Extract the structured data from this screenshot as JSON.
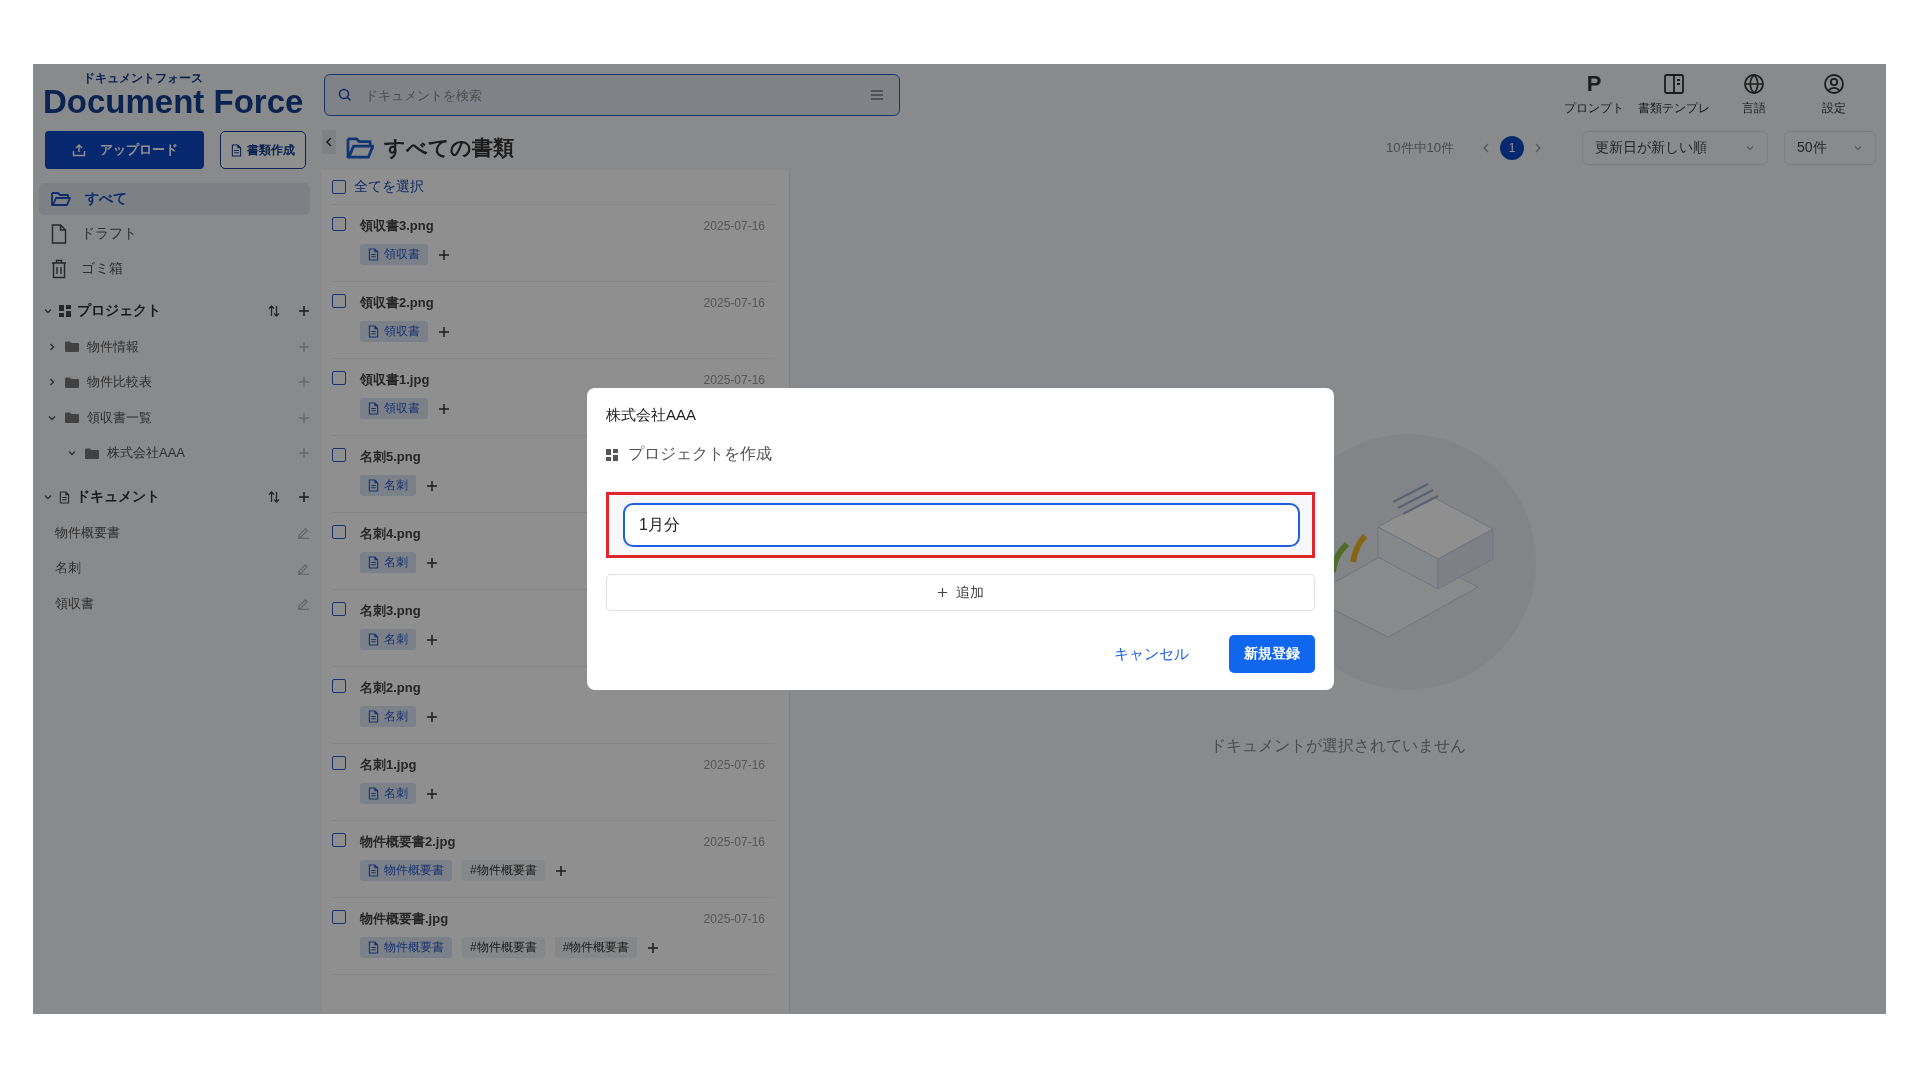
{
  "logo": {
    "kana": "ドキュメントフォース",
    "name": "Document Force"
  },
  "search": {
    "placeholder": "ドキュメントを検索"
  },
  "toolbar": [
    {
      "kind": "letter",
      "glyph": "P",
      "label": "プロンプト"
    },
    {
      "kind": "template",
      "label": "書類テンプレ"
    },
    {
      "kind": "globe",
      "label": "言語"
    },
    {
      "kind": "user",
      "label": "設定"
    }
  ],
  "sidebar": {
    "upload": "アップロード",
    "create": "書類作成",
    "nav": [
      {
        "kind": "folder",
        "label": "すべて",
        "selected": true
      },
      {
        "kind": "file",
        "label": "ドラフト",
        "selected": false
      },
      {
        "kind": "trash",
        "label": "ゴミ箱",
        "selected": false
      }
    ],
    "projects": {
      "title": "プロジェクト",
      "expanded": true,
      "children": [
        {
          "label": "物件情報",
          "expanded": false
        },
        {
          "label": "物件比較表",
          "expanded": false
        },
        {
          "label": "領収書一覧",
          "expanded": true,
          "children": [
            {
              "label": "株式会社AAA",
              "expanded": true
            }
          ]
        }
      ]
    },
    "documents": {
      "title": "ドキュメント",
      "expanded": true,
      "items": [
        "物件概要書",
        "名刺",
        "領収書"
      ]
    }
  },
  "list": {
    "title": "すべての書類",
    "select_all": {
      "label": "全てを選択",
      "checked": false
    },
    "count": "10件中10件",
    "pages": [
      {
        "label": "1",
        "selected": true
      }
    ],
    "sort": "更新日が新しい順",
    "per_page": "50件",
    "rows": [
      {
        "name": "領収書3.png",
        "date": "2025-07-16",
        "checked": false,
        "tags": [
          {
            "kind": "type",
            "label": "領収書"
          }
        ]
      },
      {
        "name": "領収書2.png",
        "date": "2025-07-16",
        "checked": false,
        "tags": [
          {
            "kind": "type",
            "label": "領収書"
          }
        ]
      },
      {
        "name": "領収書1.jpg",
        "date": "2025-07-16",
        "checked": false,
        "tags": [
          {
            "kind": "type",
            "label": "領収書"
          }
        ]
      },
      {
        "name": "名刺5.png",
        "checked": false,
        "tags": [
          {
            "kind": "type",
            "label": "名刺"
          }
        ]
      },
      {
        "name": "名刺4.png",
        "checked": false,
        "tags": [
          {
            "kind": "type",
            "label": "名刺"
          }
        ]
      },
      {
        "name": "名刺3.png",
        "checked": false,
        "tags": [
          {
            "kind": "type",
            "label": "名刺"
          }
        ]
      },
      {
        "name": "名刺2.png",
        "checked": false,
        "tags": [
          {
            "kind": "type",
            "label": "名刺"
          }
        ]
      },
      {
        "name": "名刺1.jpg",
        "date": "2025-07-16",
        "checked": false,
        "tags": [
          {
            "kind": "type",
            "label": "名刺"
          }
        ]
      },
      {
        "name": "物件概要書2.jpg",
        "date": "2025-07-16",
        "checked": false,
        "tags": [
          {
            "kind": "type",
            "label": "物件概要書"
          },
          {
            "kind": "hashtag",
            "label": "#物件概要書"
          }
        ]
      },
      {
        "name": "物件概要書.jpg",
        "date": "2025-07-16",
        "checked": false,
        "tags": [
          {
            "kind": "type",
            "label": "物件概要書"
          },
          {
            "kind": "hashtag",
            "label": "#物件概要書"
          },
          {
            "kind": "hashtag",
            "label": "#物件概要書"
          }
        ]
      }
    ]
  },
  "empty": {
    "message": "ドキュメントが選択されていません"
  },
  "dialog": {
    "breadcrumb": "株式会社AAA",
    "title": "プロジェクトを作成",
    "input": {
      "value": "1月分"
    },
    "add": "追加",
    "cancel": "キャンセル",
    "submit": "新規登録"
  }
}
